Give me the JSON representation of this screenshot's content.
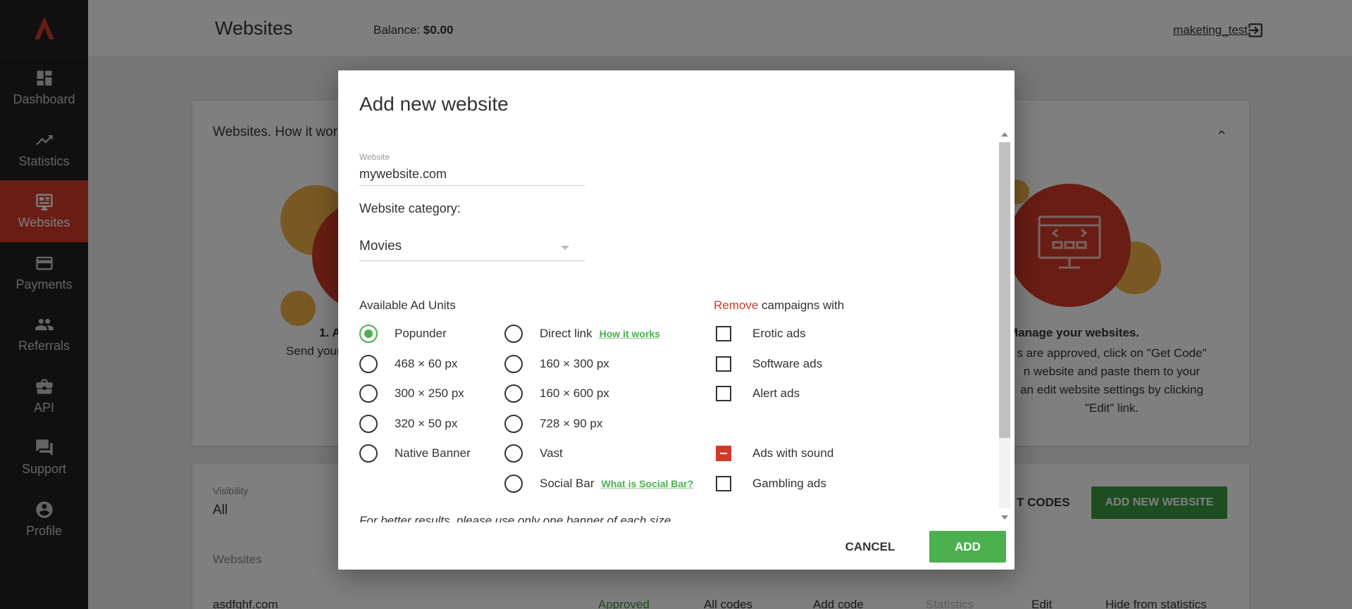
{
  "sidebar": {
    "items": [
      {
        "label": "Dashboard",
        "icon": "dashboard-icon"
      },
      {
        "label": "Statistics",
        "icon": "trending-up-icon"
      },
      {
        "label": "Websites",
        "icon": "website-icon",
        "active": true
      },
      {
        "label": "Payments",
        "icon": "credit-card-icon"
      },
      {
        "label": "Referrals",
        "icon": "people-icon"
      },
      {
        "label": "API",
        "icon": "briefcase-icon"
      },
      {
        "label": "Support",
        "icon": "chat-icon"
      },
      {
        "label": "Profile",
        "icon": "account-icon"
      }
    ]
  },
  "header": {
    "title": "Websites",
    "balance_label": "Balance:",
    "balance_value": "$0.00",
    "username": "maketing_test"
  },
  "how_it_works": {
    "title": "Websites. How it wor",
    "step1_title": "1. A",
    "step1_text": "Send your",
    "step3_title": "Manage your websites.",
    "step3_lines": [
      "s are approved, click on \"Get Code\"",
      "n website and paste them to your",
      "an edit website settings by clicking",
      "\"Edit\" link."
    ]
  },
  "list": {
    "visibility_label": "Visibility",
    "visibility_value": "All",
    "get_codes_label": "T CODES",
    "add_new_website_label": "ADD NEW WEBSITE",
    "websites_column": "Websites",
    "row": {
      "domain": "asdfghf.com",
      "status": "Approved",
      "all_codes": "All codes",
      "add_code": "Add code",
      "statistics": "Statistics",
      "edit": "Edit",
      "hide": "Hide from statistics"
    }
  },
  "modal": {
    "title": "Add new website",
    "website_label": "Website",
    "website_value": "mywebsite.com",
    "category_label": "Website category:",
    "category_value": "Movies",
    "ad_units_title": "Available Ad Units",
    "remove_word": "Remove",
    "remove_rest": " campaigns with",
    "ad_units_col1": [
      "Popunder",
      "468 × 60 px",
      "300 × 250 px",
      "320 × 50 px",
      "Native Banner"
    ],
    "ad_units_col2": [
      "Direct link",
      "160 × 300 px",
      "160 × 600 px",
      "728 × 90 px",
      "Vast",
      "Social Bar"
    ],
    "how_it_works_link": "How it works",
    "what_is_social_bar_link": "What is Social Bar?",
    "campaigns": [
      "Erotic ads",
      "Software ads",
      "Alert ads",
      "Ads with sound",
      "Gambling ads"
    ],
    "note": "For better results, please use only one banner of each size.",
    "cancel_label": "CANCEL",
    "add_label": "ADD"
  },
  "colors": {
    "accent_red": "#d23a28",
    "accent_green": "#4caf50",
    "sidebar_bg": "#212121"
  }
}
